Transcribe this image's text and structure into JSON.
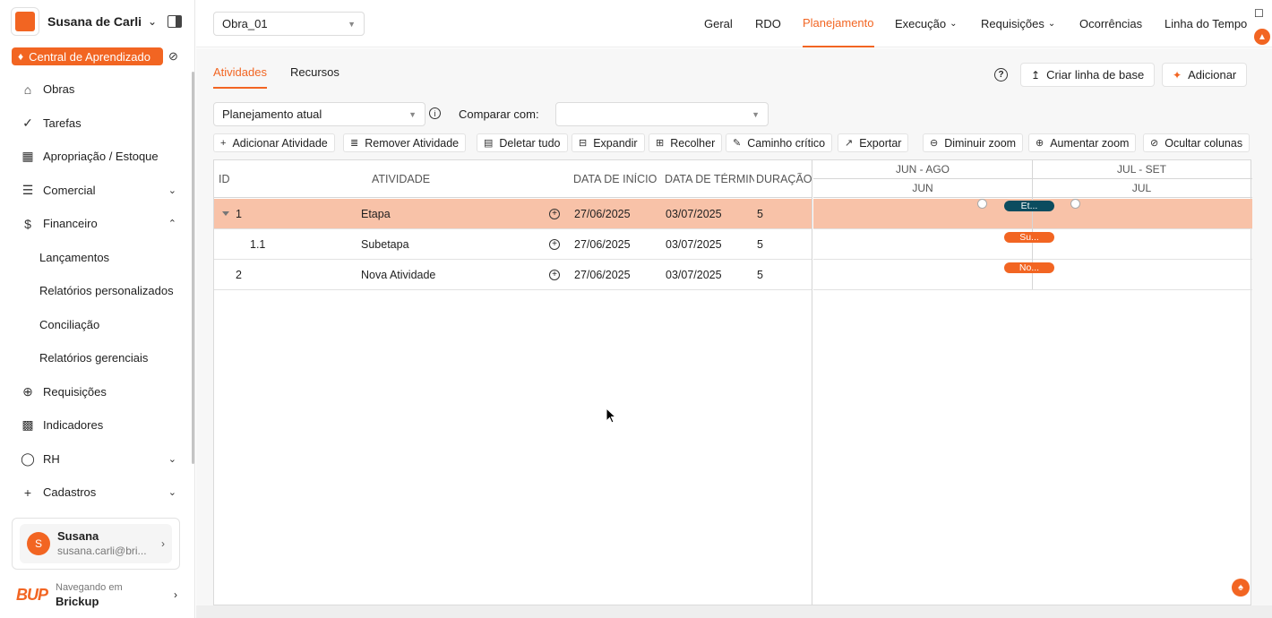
{
  "sidebar": {
    "user_name": "Susana de Carli",
    "learning_center": "Central de Aprendizado",
    "items": [
      {
        "label": "Obras",
        "icon": "bank-icon"
      },
      {
        "label": "Tarefas",
        "icon": "check-circle-icon"
      },
      {
        "label": "Apropriação / Estoque",
        "icon": "grid-icon"
      },
      {
        "label": "Comercial",
        "icon": "barcode-icon",
        "caret": "down"
      },
      {
        "label": "Financeiro",
        "icon": "dollar-circle-icon",
        "caret": "up"
      },
      {
        "label": "Lançamentos",
        "sub": true
      },
      {
        "label": "Relatórios personalizados",
        "sub": true
      },
      {
        "label": "Conciliação",
        "sub": true
      },
      {
        "label": "Relatórios gerenciais",
        "sub": true
      },
      {
        "label": "Requisições",
        "icon": "cart-icon"
      },
      {
        "label": "Indicadores",
        "icon": "bar-chart-icon"
      },
      {
        "label": "RH",
        "icon": "person-icon",
        "caret": "down"
      },
      {
        "label": "Cadastros",
        "icon": "plus-icon",
        "caret": "down"
      }
    ],
    "account": {
      "initial": "S",
      "name": "Susana",
      "email": "susana.carli@bri..."
    },
    "brand": {
      "logo": "BUP",
      "label": "Navegando em",
      "name": "Brickup"
    }
  },
  "topbar": {
    "project": "Obra_01",
    "nav": [
      "Geral",
      "RDO",
      "Planejamento",
      "Execução",
      "Requisições",
      "Ocorrências",
      "Linha do Tempo"
    ]
  },
  "main": {
    "tabs": [
      "Atividades",
      "Recursos"
    ],
    "actions": {
      "baseline": "Criar linha de base",
      "add": "Adicionar"
    },
    "plan_select": "Planejamento atual",
    "compare_label": "Comparar com:",
    "toolbar": [
      "Adicionar Atividade",
      "Remover Atividade",
      "Deletar tudo",
      "Expandir",
      "Recolher",
      "Caminho crítico",
      "Exportar",
      "Diminuir zoom",
      "Aumentar zoom",
      "Ocultar colunas"
    ],
    "columns": [
      "ID",
      "ATIVIDADE",
      "DATA DE INÍCIO",
      "DATA DE TÉRMINO",
      "DURAÇÃO"
    ],
    "rows": [
      {
        "id": "1",
        "name": "Etapa",
        "start": "27/06/2025",
        "end": "03/07/2025",
        "duration": "5"
      },
      {
        "id": "1.1",
        "name": "Subetapa",
        "start": "27/06/2025",
        "end": "03/07/2025",
        "duration": "5"
      },
      {
        "id": "2",
        "name": "Nova Atividade",
        "start": "27/06/2025",
        "end": "03/07/2025",
        "duration": "5"
      }
    ],
    "gantt": {
      "top_scale": [
        "JUN - AGO",
        "JUL - SET"
      ],
      "bottom_scale": [
        "JUN",
        "JUL"
      ],
      "bars": [
        "Et...",
        "Su...",
        "No..."
      ]
    }
  }
}
